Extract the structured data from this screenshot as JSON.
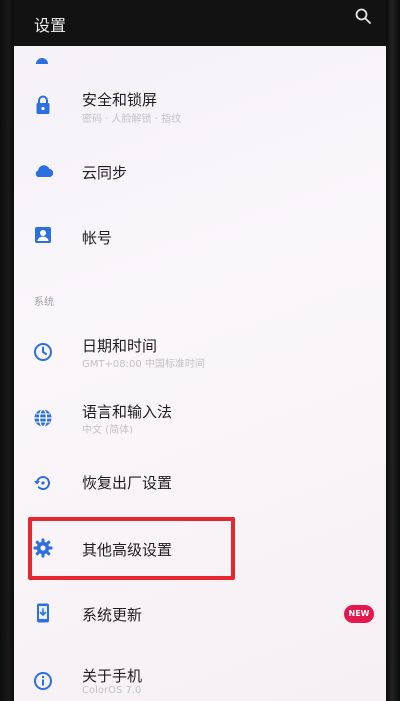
{
  "header": {
    "title": "设置",
    "search_icon": "search-icon"
  },
  "colors": {
    "accent": "#2b6fe0",
    "highlight": "#e8262d",
    "badge": "#e4184c",
    "header_bg": "#121212"
  },
  "sections": {
    "system_label": "系统"
  },
  "items": [
    {
      "id": "security",
      "icon": "lock-icon",
      "title": "安全和锁屏",
      "subtitle": "密码 · 人脸解锁 · 指纹"
    },
    {
      "id": "cloud",
      "icon": "cloud-icon",
      "title": "云同步",
      "subtitle": ""
    },
    {
      "id": "account",
      "icon": "account-icon",
      "title": "帐号",
      "subtitle": ""
    },
    {
      "id": "datetime",
      "icon": "clock-icon",
      "title": "日期和时间",
      "subtitle": "GMT+08:00 中国标准时间"
    },
    {
      "id": "language",
      "icon": "globe-icon",
      "title": "语言和输入法",
      "subtitle": "中文 (简体)"
    },
    {
      "id": "reset",
      "icon": "restore-icon",
      "title": "恢复出厂设置",
      "subtitle": ""
    },
    {
      "id": "advanced",
      "icon": "gear-icon",
      "title": "其他高级设置",
      "subtitle": ""
    },
    {
      "id": "update",
      "icon": "system-update-icon",
      "title": "系统更新",
      "subtitle": "",
      "badge": "NEW"
    },
    {
      "id": "about",
      "icon": "info-icon",
      "title": "关于手机",
      "subtitle": "ColorOS 7.0"
    }
  ]
}
